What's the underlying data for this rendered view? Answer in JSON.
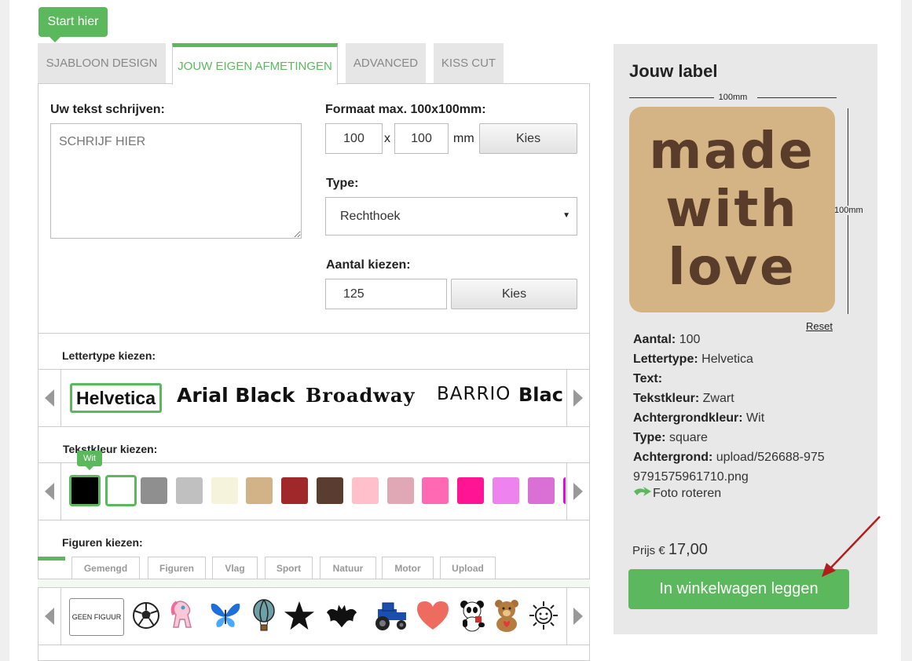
{
  "start_hier": "Start hier",
  "tabs": [
    {
      "label": "SJABLOON DESIGN"
    },
    {
      "label": "JOUW EIGEN AFMETINGEN"
    },
    {
      "label": "ADVANCED"
    },
    {
      "label": "KISS CUT"
    }
  ],
  "text_section": {
    "label": "Uw tekst schrijven:",
    "placeholder": "SCHRIJF HIER"
  },
  "format": {
    "label": "Formaat max. 100x100mm:",
    "width": "100",
    "x": "x",
    "height": "100",
    "unit": "mm",
    "choose": "Kies"
  },
  "type": {
    "label": "Type:",
    "selected": "Rechthoek"
  },
  "quantity": {
    "label": "Aantal kiezen:",
    "value": "125",
    "choose": "Kies"
  },
  "fonts": {
    "label": "Lettertype kiezen:",
    "items": [
      "Helvetica",
      "Arial Black",
      "Broadway",
      "BARRIO",
      "Blac"
    ]
  },
  "colors": {
    "label": "Tekstkleur kiezen:",
    "tooltip": "Wit",
    "swatches": [
      "#000000",
      "#ffffff",
      "#8f8f8f",
      "#c0c0c0",
      "#f5f3dc",
      "#d1b387",
      "#a0282a",
      "#5a3c30",
      "#ffc0cb",
      "#e0a8b4",
      "#ff69b4",
      "#ff1493",
      "#ee82ee",
      "#da70d6",
      "#ee00ee"
    ]
  },
  "figures": {
    "label": "Figuren kiezen:",
    "tabs": [
      "Gemengd",
      "Figuren",
      "Vlag",
      "Sport",
      "Natuur",
      "Motor",
      "Upload"
    ],
    "none": "GEEN FIGUUR",
    "icons": [
      "soccer-ball-icon",
      "pony-icon",
      "butterfly-icon",
      "hot-air-balloon-icon",
      "star-icon",
      "bat-icon",
      "tractor-icon",
      "heart-icon",
      "panda-icon",
      "teddy-bear-icon",
      "sun-icon"
    ]
  },
  "preview": {
    "title": "Jouw label",
    "dim_width": "100mm",
    "dim_height": "100mm",
    "label_lines": [
      "made",
      "with",
      "love"
    ],
    "label_bg": "#d4b385",
    "label_text_color": "#5a3c2b",
    "reset": "Reset"
  },
  "summary": {
    "aantal_k": "Aantal:",
    "aantal_v": "100",
    "lettertype_k": "Lettertype:",
    "lettertype_v": "Helvetica",
    "text_k": "Text:",
    "tekstkleur_k": "Tekstkleur:",
    "tekstkleur_v": "Zwart",
    "achtergrondkleur_k": "Achtergrondkleur:",
    "achtergrondkleur_v": "Wit",
    "type_k": "Type:",
    "type_v": "square",
    "achtergrond_k": "Achtergrond:",
    "achtergrond_v": "upload/526688-9759791575961710.png",
    "rotate": "Foto roteren"
  },
  "price": {
    "prefix": "Prijs €",
    "amount": "17,00"
  },
  "cart_button": "In winkelwagen leggen",
  "accent": "#5cb85c"
}
